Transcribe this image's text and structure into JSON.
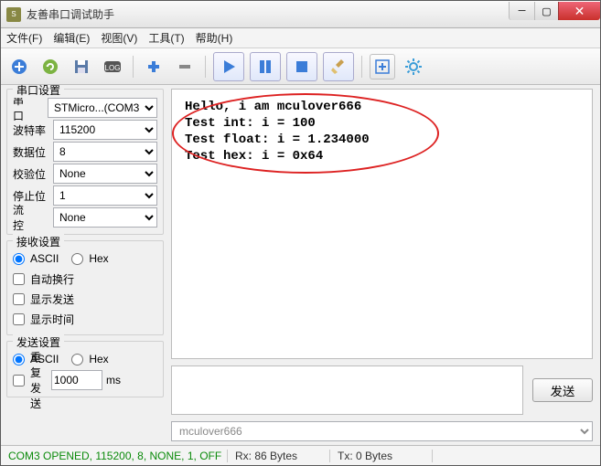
{
  "title": "友善串口调试助手",
  "menu": {
    "file": "文件(F)",
    "edit": "编辑(E)",
    "view": "视图(V)",
    "tool": "工具(T)",
    "help": "帮助(H)"
  },
  "serial": {
    "legend": "串口设置",
    "port_label": "串 口",
    "port": "STMicro...(COM3",
    "baud_label": "波特率",
    "baud": "115200",
    "databit_label": "数据位",
    "databit": "8",
    "parity_label": "校验位",
    "parity": "None",
    "stopbit_label": "停止位",
    "stopbit": "1",
    "flow_label": "流 控",
    "flow": "None"
  },
  "recv": {
    "legend": "接收设置",
    "ascii": "ASCII",
    "hex": "Hex",
    "autowrap": "自动换行",
    "showsend": "显示发送",
    "showtime": "显示时间"
  },
  "send": {
    "legend": "发送设置",
    "ascii": "ASCII",
    "hex": "Hex",
    "repeat": "重复发送",
    "interval": "1000",
    "ms": "ms"
  },
  "rxtext": "Hello, i am mculover666\nTest int: i = 100\nTest float: i = 1.234000\nTest hex: i = 0x64",
  "sendbtn": "发送",
  "hist": "mculover666",
  "status": {
    "conn": "COM3 OPENED, 115200, 8, NONE, 1, OFF",
    "rx": "Rx: 86 Bytes",
    "tx": "Tx: 0 Bytes"
  }
}
